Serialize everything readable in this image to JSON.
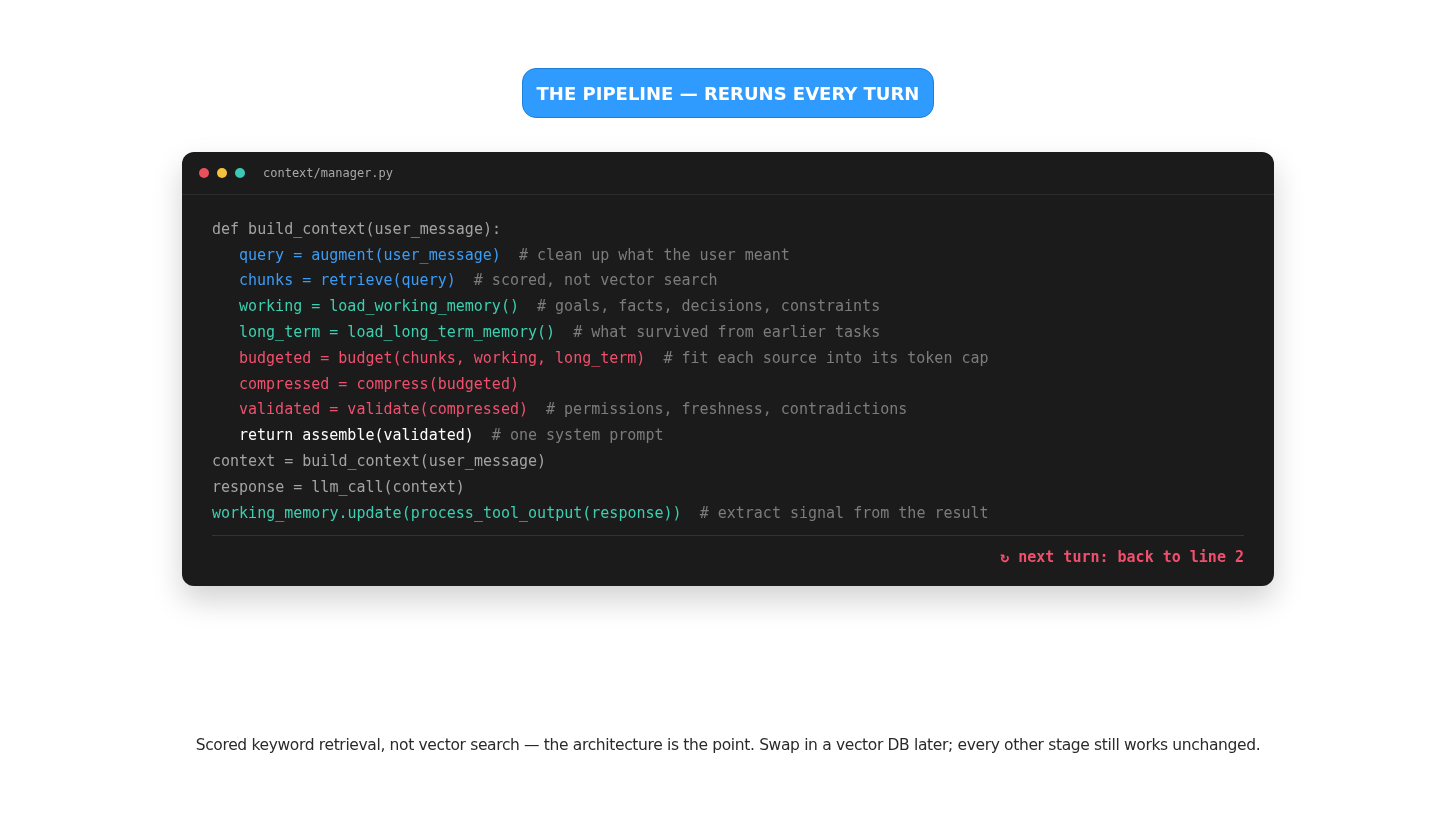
{
  "badge": "THE PIPELINE — RERUNS EVERY TURN",
  "editor": {
    "window_dots": [
      {
        "color": "#e8505b"
      },
      {
        "color": "#f5c33b"
      },
      {
        "color": "#3cc8b4"
      }
    ],
    "filename": "context/manager.py",
    "lines": [
      {
        "kind": "plain",
        "code": "def build_context(user_message):",
        "children": [
          {
            "kind": "query",
            "code": "query = augment(user_message)",
            "comment": "# clean up what the user meant"
          },
          {
            "kind": "query",
            "code": "chunks = retrieve(query)",
            "comment": "# scored, not vector search"
          },
          {
            "kind": "memory",
            "code": "working = load_working_memory()",
            "comment": "# goals, facts, decisions, constraints"
          },
          {
            "kind": "memory",
            "code": "long_term = load_long_term_memory()",
            "comment": "# what survived from earlier tasks"
          },
          {
            "kind": "budget",
            "code": "budgeted = budget(chunks, working, long_term)",
            "comment": "# fit each source into its token cap"
          },
          {
            "kind": "budget",
            "code": "compressed = compress(budgeted)"
          },
          {
            "kind": "budget",
            "code": "validated = validate(compressed)",
            "comment": "# permissions, freshness, contradictions"
          },
          {
            "kind": "return",
            "code": "return assemble(validated)",
            "comment": "# one system prompt"
          }
        ]
      },
      {
        "kind": "plain",
        "code": "context = build_context(user_message)"
      },
      {
        "kind": "plain",
        "code": "response = llm_call(context)"
      },
      {
        "kind": "memory",
        "code": "working_memory.update(process_tool_output(response))",
        "comment": "# extract signal from the result"
      }
    ],
    "footer": "↻ next turn: back to line 2"
  },
  "caption": "Scored keyword retrieval, not vector search — the architecture is the point. Swap in a vector DB later; every other stage still works unchanged."
}
